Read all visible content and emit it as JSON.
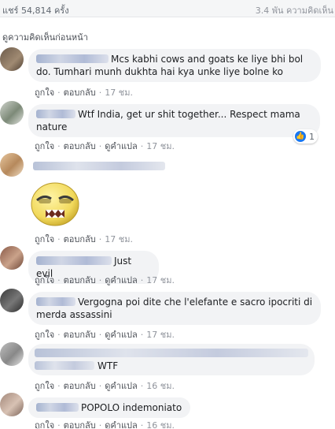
{
  "header": {
    "shares": "แชร์ 54,814 ครั้ง",
    "comments_count": "3.4 พัน ความคิดเห็น"
  },
  "prev_comments_link": "ดูความคิดเห็นก่อนหน้า",
  "actions": {
    "like": "ถูกใจ",
    "reply": "ตอบกลับ",
    "translate": "ดูคำแปล",
    "sep": "·"
  },
  "comments": [
    {
      "text_line1": "Mcs kabhi cows and goats ke liye bhi bol",
      "text_line2": "do. Tumhari munh dukhta hai kya unke liye bolne ko",
      "time": "17 ชม."
    },
    {
      "text_line1": "Wtf India, get ur shit together... Respect mama",
      "text_line2": "nature",
      "time": "17 ชม.",
      "reaction_count": "1"
    },
    {
      "time": "17 ชม."
    },
    {
      "text": "Just evil",
      "time": "17 ชม."
    },
    {
      "text_line1": "Vergogna poi dite che l'elefante e sacro ipocriti di",
      "text_line2": "merda assassini",
      "time": "17 ชม."
    },
    {
      "text": "WTF",
      "time": "16 ชม."
    },
    {
      "text": "POPOLO indemoniato",
      "time": "16 ชม."
    }
  ],
  "colors": {
    "bubble": "#f2f3f5",
    "like": "#1877f2",
    "link": "#4b4f56",
    "meta": "#90949c"
  }
}
